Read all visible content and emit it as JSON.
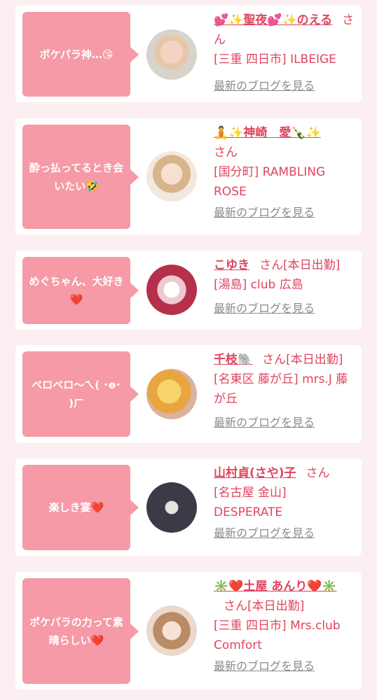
{
  "colors": {
    "background": "#fbeff1",
    "bubble": "#f59aa6",
    "accent": "#e0445e",
    "link": "#8a8a8a"
  },
  "cards": [
    {
      "comment": "ポケパラ神…😘",
      "name": "💕✨聖夜💕✨のえる",
      "suffix": "さん",
      "shop": "[三重 四日市] ILBEIGE",
      "blog_link": "最新のブログを見る"
    },
    {
      "comment": "酔っ払ってるとき会いたい🤣",
      "name": "🧘✨神崎　愛🍾✨",
      "suffix": "さん",
      "shop": "[国分町] RAMBLING ROSE",
      "blog_link": "最新のブログを見る"
    },
    {
      "comment": "めぐちゃん、大好き❤️",
      "name": "こゆき",
      "suffix": "さん[本日出勤]",
      "shop": "[湯島] club 広島",
      "blog_link": "最新のブログを見る"
    },
    {
      "comment": "ベロベロ〜ㄟ( ･ө･ )ㄏ",
      "name": "千枝🐘",
      "suffix": "さん[本日出勤]",
      "shop": "[名東区 藤が丘] mrs.J 藤が丘",
      "blog_link": "最新のブログを見る"
    },
    {
      "comment": "楽しき宴❤️",
      "name": "山村貞(さや)子",
      "suffix": "さん",
      "shop": "[名古屋 金山] DESPERATE",
      "blog_link": "最新のブログを見る"
    },
    {
      "comment": "ポケパラの力って素晴らしい❤️",
      "name": "✳️❤️土屋 あんり❤️✳️",
      "suffix": "さん[本日出勤]",
      "shop": "[三重 四日市] Mrs.club Comfort",
      "blog_link": "最新のブログを見る"
    }
  ]
}
